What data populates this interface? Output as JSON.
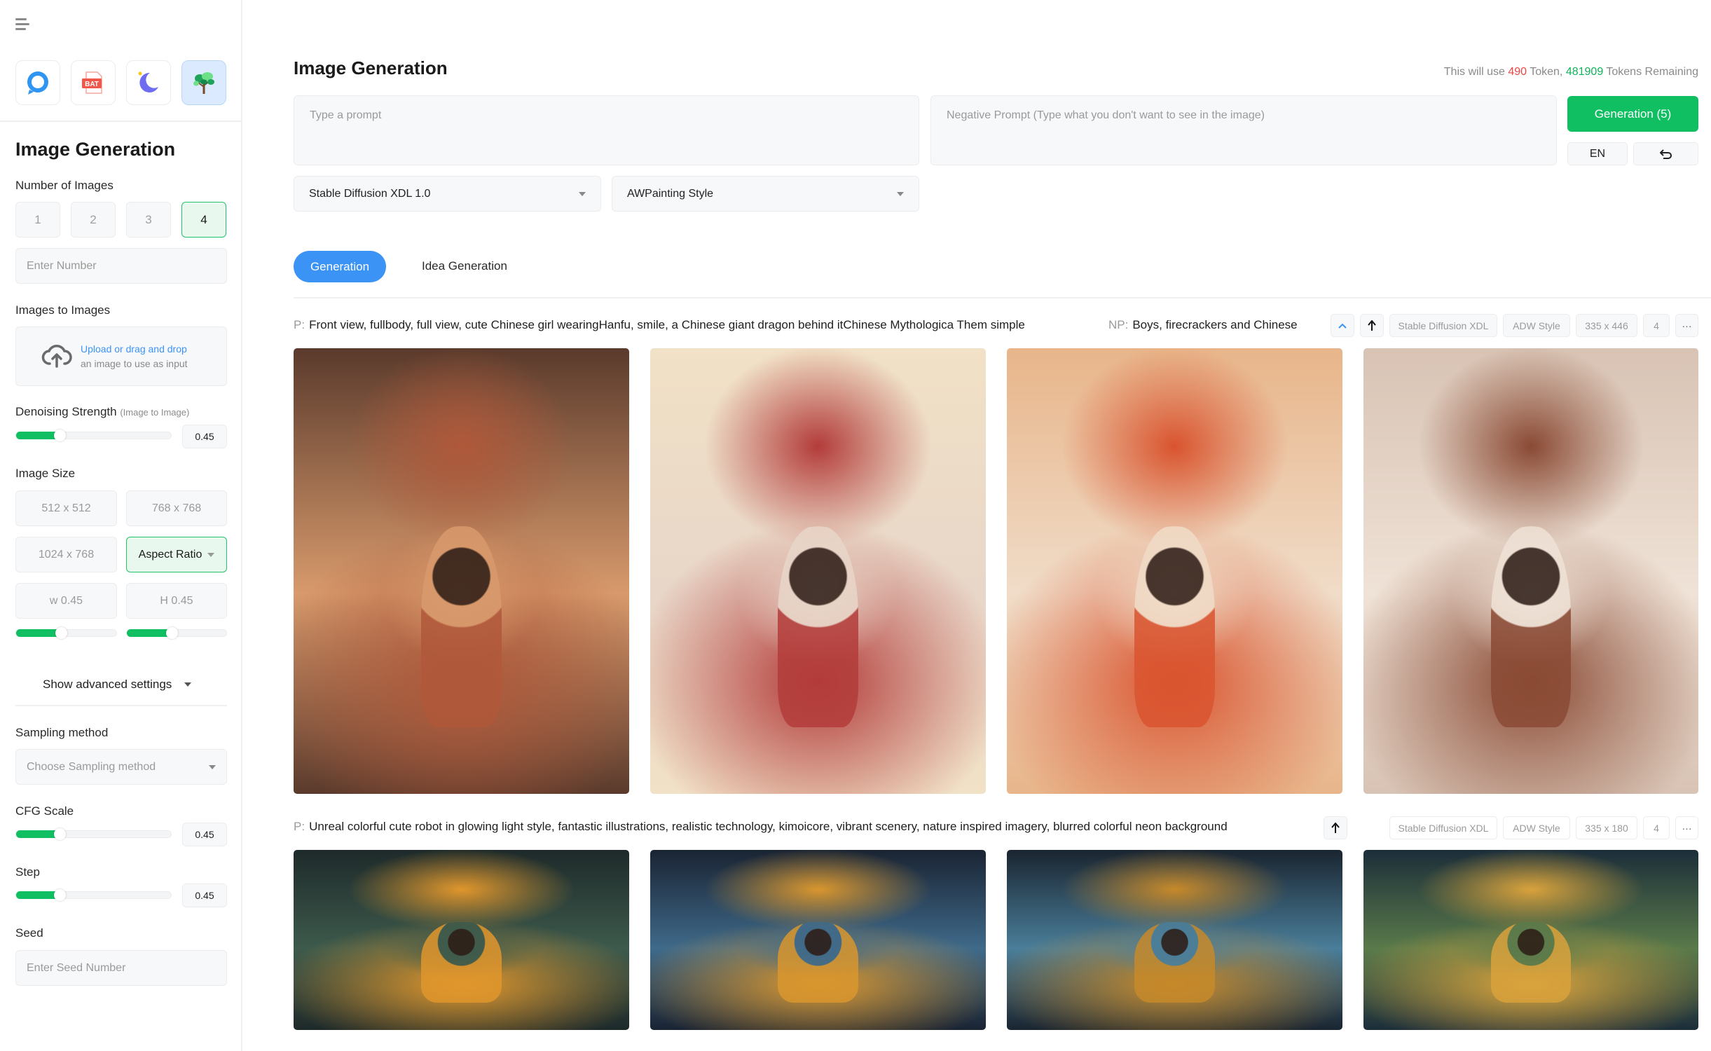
{
  "sidebar": {
    "menu_icon": "hamburger-menu-icon",
    "apps": [
      {
        "name": "chat-bubble-app",
        "icon": "chat-bubble-icon",
        "color": "#2f95f3",
        "active": false
      },
      {
        "name": "bat-file-app",
        "icon": "bat-file-icon",
        "label": "BAT",
        "color": "#f0574a",
        "active": false
      },
      {
        "name": "moon-bot-app",
        "icon": "moon-bot-icon",
        "color": "#6e6cf0",
        "active": false
      },
      {
        "name": "tree-app",
        "icon": "tree-icon",
        "color": "#22c36b",
        "active": true
      }
    ],
    "title": "Image Generation",
    "number_of_images": {
      "label": "Number of Images",
      "options": [
        "1",
        "2",
        "3",
        "4"
      ],
      "selected": "4",
      "input_placeholder": "Enter Number"
    },
    "images_to_images": {
      "label": "Images to Images",
      "upload_link": "Upload or drag and drop",
      "upload_hint": "an image to use as input"
    },
    "denoising": {
      "label": "Denoising Strength",
      "sublabel": "(Image to Image)",
      "value": "0.45",
      "fraction": 0.28
    },
    "image_size": {
      "label": "Image Size",
      "options": [
        "512 x 512",
        "768 x 768",
        "1024 x 768"
      ],
      "aspect_ratio_label": "Aspect Ratio",
      "width_label": "w 0.45",
      "height_label": "H 0.45",
      "width_fraction": 0.45,
      "height_fraction": 0.45
    },
    "advanced_settings_label": "Show advanced settings",
    "sampling": {
      "label": "Sampling method",
      "placeholder": "Choose Sampling method"
    },
    "cfg_scale": {
      "label": "CFG Scale",
      "value": "0.45",
      "fraction": 0.28
    },
    "step": {
      "label": "Step",
      "value": "0.45",
      "fraction": 0.28
    },
    "seed": {
      "label": "Seed",
      "placeholder": "Enter Seed Number"
    }
  },
  "main": {
    "title": "Image Generation",
    "token_info": {
      "prefix": "This will use",
      "use": "490",
      "middle": "Token,",
      "remaining": "481909",
      "suffix": "Tokens Remaining"
    },
    "prompt_placeholder": "Type a prompt",
    "negative_prompt_placeholder": "Negative Prompt (Type what you don't want to see in the image)",
    "generate_button": "Generation (5)",
    "language_button": "EN",
    "undo_icon": "undo-icon",
    "model_select": "Stable Diffusion XDL 1.0",
    "style_select": "AWPainting Style",
    "tabs": [
      {
        "label": "Generation",
        "active": true
      },
      {
        "label": "Idea Generation",
        "active": false
      }
    ],
    "results": [
      {
        "prompt_prefix": "P:",
        "prompt": "Front view, fullbody, full view, cute Chinese girl wearingHanfu, smile, a Chinese giant dragon behind itChinese Mythologica Them simple",
        "negative_prefix": "NP:",
        "negative_prompt": "Boys, firecrackers and Chinese",
        "model": "Stable Diffusion XDL",
        "style": "ADW Style",
        "size": "335 x 446",
        "count": "4",
        "images": [
          {
            "alt": "Chibi girl in red Hanfu in front of a giant orange Chinese dragon",
            "colors": [
              "#5a3a2c",
              "#b0583a",
              "#d89a6c"
            ]
          },
          {
            "alt": "Smiling girl in red Hanfu before a red and white dragon",
            "colors": [
              "#f1e1c6",
              "#b33c3a",
              "#e8d6c8"
            ]
          },
          {
            "alt": "Laughing girl in red robe beneath an orange dragon with open mouth",
            "colors": [
              "#e8b58a",
              "#d9542f",
              "#f0dcc8"
            ]
          },
          {
            "alt": "Winking girl in white coat in front of a fluffy brown dragon",
            "colors": [
              "#d8c3b4",
              "#8a4a34",
              "#efe2d6"
            ]
          }
        ]
      },
      {
        "prompt_prefix": "P:",
        "prompt": "Unreal colorful cute robot in glowing light style, fantastic illustrations, realistic technology, kimoicore, vibrant scenery, nature inspired imagery, blurred colorful neon background",
        "model": "Stable Diffusion XDL",
        "style": "ADW Style",
        "size": "335 x 180",
        "count": "4",
        "images": [
          {
            "alt": "Cute yellow-helmet robot in a glowing forest",
            "colors": [
              "#1e2a2a",
              "#e0962c",
              "#3d5a4c"
            ]
          },
          {
            "alt": "Small golden robot standing among bokeh lights",
            "colors": [
              "#1a2433",
              "#d9962e",
              "#3f6a8a"
            ]
          },
          {
            "alt": "Robot with round screen face among pink flowers",
            "colors": [
              "#1a2530",
              "#c6892a",
              "#4a7e9a"
            ]
          },
          {
            "alt": "Yellow robot standing near daisies and glowing orbs",
            "colors": [
              "#1c2e3a",
              "#d9a23c",
              "#5a7a4a"
            ]
          }
        ]
      }
    ],
    "row_icons": {
      "collapse": "chevron-up-icon",
      "upload": "arrow-up-icon",
      "more": "more-icon"
    },
    "more_label": "···"
  }
}
